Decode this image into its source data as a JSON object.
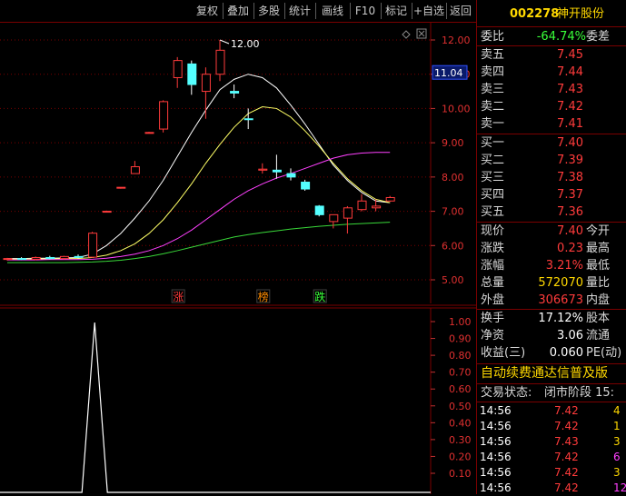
{
  "toolbar": {
    "buttons": [
      "复权",
      "叠加",
      "多股",
      "统计",
      "画线",
      "F10",
      "标记",
      "+自选",
      "返回"
    ]
  },
  "chart": {
    "price_axis": [
      "12.00",
      "11.00",
      "10.00",
      "9.00",
      "8.00",
      "7.00",
      "6.00",
      "5.00"
    ],
    "price_min": 4.5,
    "price_max": 12.4,
    "current_price_tag": "11.04",
    "high_annotation": "12.00",
    "event_labels": [
      {
        "text": "涨",
        "color": "#ff3b3b",
        "index": 12
      },
      {
        "text": "榜",
        "color": "#ff8c00",
        "index": 18
      },
      {
        "text": "跌",
        "color": "#39ff39",
        "index": 22
      }
    ],
    "volume_axis": [
      "1.00",
      "0.90",
      "0.80",
      "0.70",
      "0.60",
      "0.50",
      "0.40",
      "0.30",
      "0.20",
      "0.10"
    ],
    "candles": [
      {
        "o": 5.6,
        "h": 5.64,
        "l": 5.56,
        "c": 5.62
      },
      {
        "o": 5.62,
        "h": 5.66,
        "l": 5.58,
        "c": 5.6
      },
      {
        "o": 5.6,
        "h": 5.68,
        "l": 5.57,
        "c": 5.65
      },
      {
        "o": 5.65,
        "h": 5.7,
        "l": 5.6,
        "c": 5.62
      },
      {
        "o": 5.62,
        "h": 5.7,
        "l": 5.59,
        "c": 5.68
      },
      {
        "o": 5.68,
        "h": 5.74,
        "l": 5.62,
        "c": 5.66
      },
      {
        "o": 5.66,
        "h": 6.4,
        "l": 5.64,
        "c": 6.36
      },
      {
        "o": 6.98,
        "h": 7.02,
        "l": 6.98,
        "c": 7.0
      },
      {
        "o": 7.68,
        "h": 7.7,
        "l": 7.66,
        "c": 7.7
      },
      {
        "o": 8.1,
        "h": 8.47,
        "l": 8.1,
        "c": 8.3
      },
      {
        "o": 9.3,
        "h": 9.32,
        "l": 9.28,
        "c": 9.3
      },
      {
        "o": 9.4,
        "h": 10.24,
        "l": 9.3,
        "c": 10.2
      },
      {
        "o": 10.9,
        "h": 11.5,
        "l": 10.6,
        "c": 11.4
      },
      {
        "o": 11.3,
        "h": 11.4,
        "l": 10.4,
        "c": 10.7
      },
      {
        "o": 10.5,
        "h": 11.2,
        "l": 9.7,
        "c": 11.0
      },
      {
        "o": 11.0,
        "h": 12.0,
        "l": 10.8,
        "c": 11.7
      },
      {
        "o": 10.5,
        "h": 10.7,
        "l": 10.3,
        "c": 10.45
      },
      {
        "o": 9.7,
        "h": 10.0,
        "l": 9.4,
        "c": 9.68
      },
      {
        "o": 8.2,
        "h": 8.4,
        "l": 8.1,
        "c": 8.23
      },
      {
        "o": 8.2,
        "h": 8.65,
        "l": 7.95,
        "c": 8.15
      },
      {
        "o": 8.1,
        "h": 8.25,
        "l": 7.9,
        "c": 8.0
      },
      {
        "o": 7.85,
        "h": 7.92,
        "l": 7.6,
        "c": 7.65
      },
      {
        "o": 7.15,
        "h": 7.18,
        "l": 6.85,
        "c": 6.9
      },
      {
        "o": 6.7,
        "h": 6.9,
        "l": 6.5,
        "c": 6.9
      },
      {
        "o": 6.8,
        "h": 7.15,
        "l": 6.35,
        "c": 7.1
      },
      {
        "o": 7.05,
        "h": 7.5,
        "l": 7.0,
        "c": 7.3
      },
      {
        "o": 7.1,
        "h": 7.35,
        "l": 7.0,
        "c": 7.15
      },
      {
        "o": 7.3,
        "h": 7.45,
        "l": 7.28,
        "c": 7.4
      }
    ],
    "ma_lines": [
      {
        "color": "#ffffff",
        "values": [
          5.62,
          5.62,
          5.63,
          5.63,
          5.64,
          5.65,
          5.75,
          6.0,
          6.35,
          6.8,
          7.3,
          7.9,
          8.6,
          9.3,
          9.95,
          10.55,
          10.85,
          11.0,
          10.9,
          10.6,
          10.1,
          9.55,
          8.95,
          8.35,
          7.9,
          7.55,
          7.3,
          7.25
        ]
      },
      {
        "color": "#ffff66",
        "values": [
          5.6,
          5.6,
          5.61,
          5.61,
          5.62,
          5.62,
          5.65,
          5.72,
          5.85,
          6.05,
          6.35,
          6.75,
          7.25,
          7.8,
          8.4,
          8.95,
          9.45,
          9.85,
          10.05,
          10.0,
          9.75,
          9.35,
          8.9,
          8.4,
          7.95,
          7.6,
          7.35,
          7.25
        ]
      },
      {
        "color": "#ff40ff",
        "values": [
          5.58,
          5.58,
          5.58,
          5.59,
          5.59,
          5.59,
          5.6,
          5.63,
          5.68,
          5.75,
          5.85,
          6.0,
          6.2,
          6.45,
          6.75,
          7.05,
          7.35,
          7.6,
          7.8,
          7.97,
          8.1,
          8.25,
          8.4,
          8.55,
          8.65,
          8.7,
          8.72,
          8.72
        ]
      },
      {
        "color": "#39d839",
        "values": [
          5.5,
          5.5,
          5.5,
          5.5,
          5.5,
          5.51,
          5.52,
          5.54,
          5.57,
          5.62,
          5.68,
          5.76,
          5.85,
          5.95,
          6.05,
          6.15,
          6.25,
          6.32,
          6.38,
          6.43,
          6.48,
          6.52,
          6.56,
          6.59,
          6.62,
          6.64,
          6.66,
          6.68
        ]
      }
    ],
    "volume_line": {
      "color": "#ffffff",
      "peak_index": 7
    }
  },
  "quote": {
    "code": "002278",
    "name": "神开股份",
    "weibi_label": "委比",
    "weibi_value": "-64.74%",
    "weicha_label": "委差",
    "sell": [
      {
        "label": "卖五",
        "price": "7.45"
      },
      {
        "label": "卖四",
        "price": "7.44"
      },
      {
        "label": "卖三",
        "price": "7.43"
      },
      {
        "label": "卖二",
        "price": "7.42"
      },
      {
        "label": "卖一",
        "price": "7.41"
      }
    ],
    "buy": [
      {
        "label": "买一",
        "price": "7.40"
      },
      {
        "label": "买二",
        "price": "7.39"
      },
      {
        "label": "买三",
        "price": "7.38"
      },
      {
        "label": "买四",
        "price": "7.37"
      },
      {
        "label": "买五",
        "price": "7.36"
      }
    ],
    "stats1": [
      {
        "label": "现价",
        "value": "7.40",
        "right": "今开",
        "color": "red"
      },
      {
        "label": "涨跌",
        "value": "0.23",
        "right": "最高",
        "color": "red"
      },
      {
        "label": "涨幅",
        "value": "3.21%",
        "right": "最低",
        "color": "red"
      },
      {
        "label": "总量",
        "value": "572070",
        "right": "量比",
        "color": "yellow"
      },
      {
        "label": "外盘",
        "value": "306673",
        "right": "内盘",
        "color": "red"
      }
    ],
    "stats2": [
      {
        "label": "换手",
        "value": "17.12%",
        "right": "股本",
        "color": "white"
      },
      {
        "label": "净资",
        "value": "3.06",
        "right": "流通",
        "color": "white"
      },
      {
        "label": "收益(三)",
        "value": "0.060",
        "right": "PE(动)",
        "color": "white"
      }
    ],
    "promo": "自动续费通达信普及版",
    "status_label": "交易状态:",
    "status_value": "闭市阶段 15:",
    "ticks": [
      {
        "time": "14:56",
        "price": "7.42",
        "vol": "4",
        "vcolor": "#ffd800"
      },
      {
        "time": "14:56",
        "price": "7.42",
        "vol": "1",
        "vcolor": "#ffd800"
      },
      {
        "time": "14:56",
        "price": "7.43",
        "vol": "3",
        "vcolor": "#ffd800"
      },
      {
        "time": "14:56",
        "price": "7.42",
        "vol": "6",
        "vcolor": "#ff40ff"
      },
      {
        "time": "14:56",
        "price": "7.42",
        "vol": "3",
        "vcolor": "#ffd800"
      },
      {
        "time": "14:56",
        "price": "7.42",
        "vol": "12",
        "vcolor": "#ff40ff"
      }
    ]
  }
}
